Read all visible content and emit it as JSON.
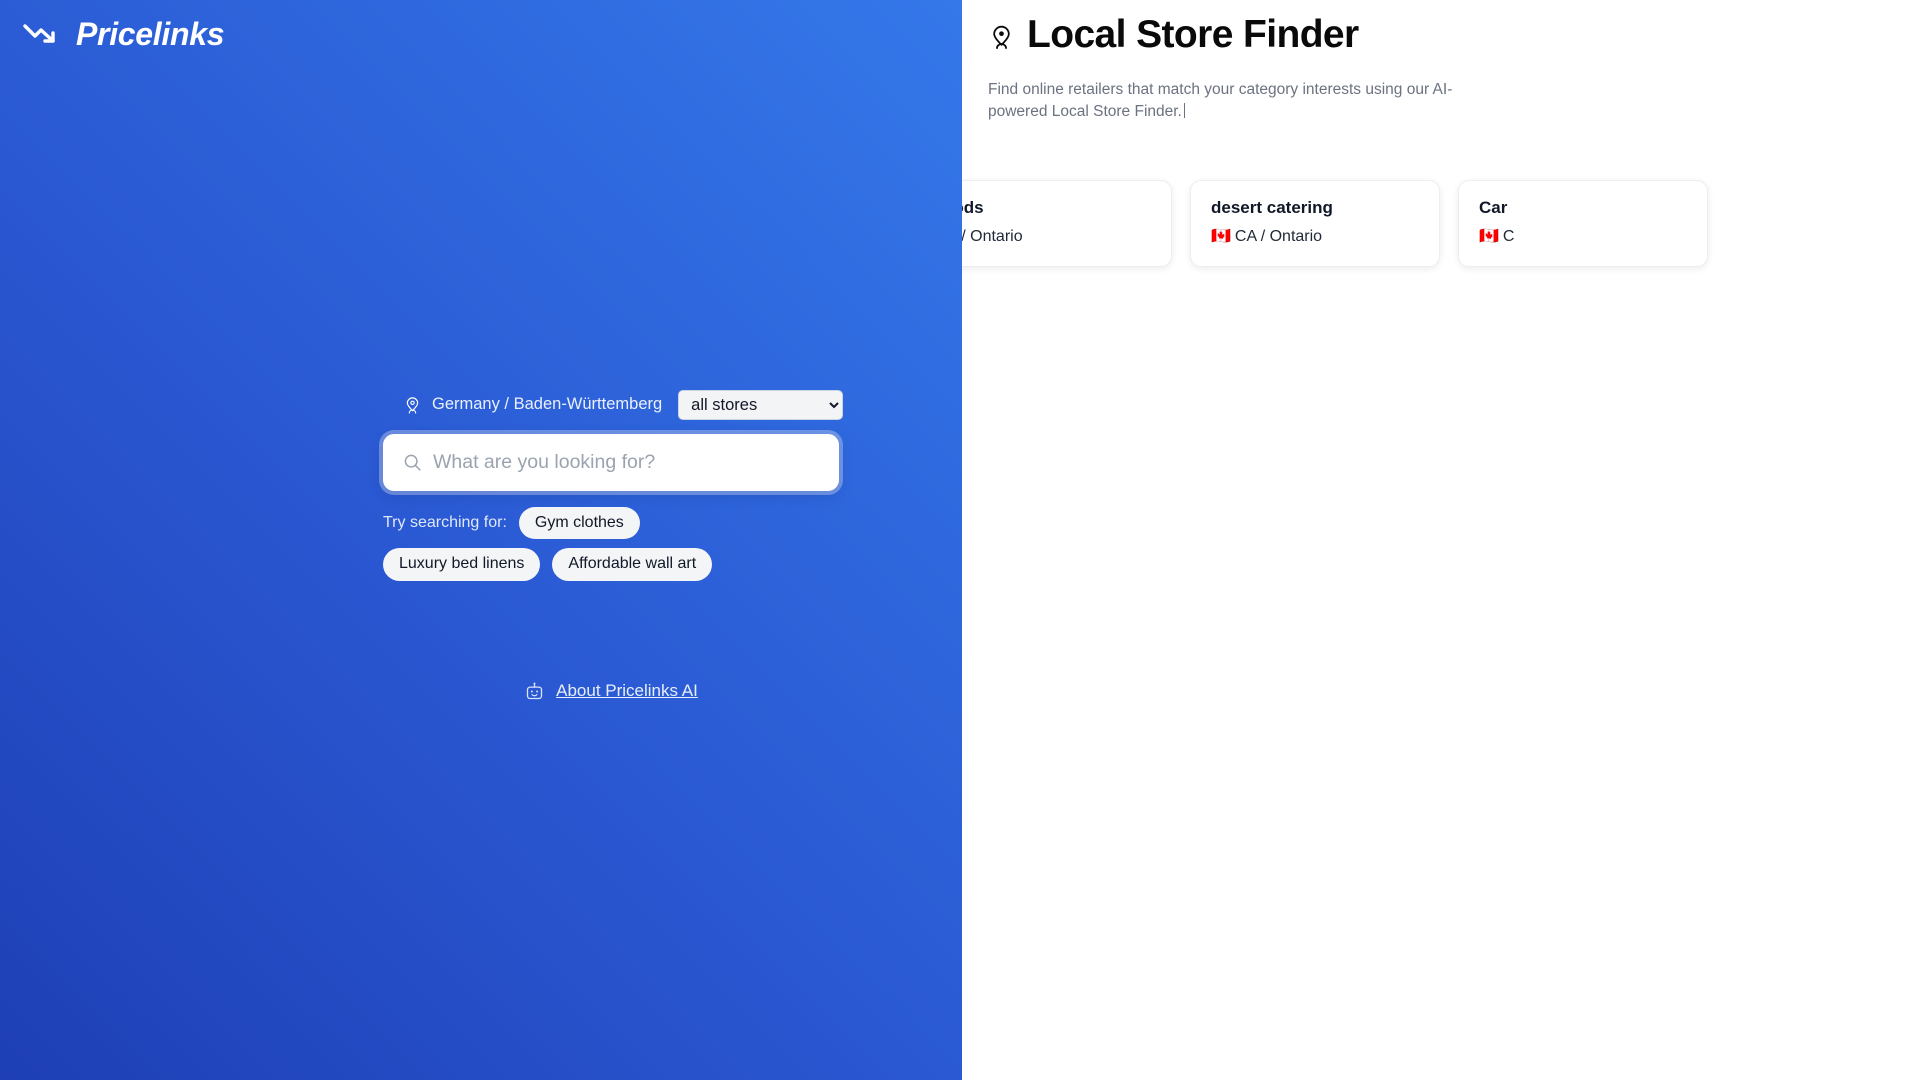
{
  "brand": {
    "name": "Pricelinks",
    "logo_icon": "trending-down-arrow-icon"
  },
  "left_panel": {
    "locale": {
      "icon": "store-locator-pin-icon",
      "text": "Germany / Baden-Württemberg"
    },
    "store_filter": {
      "selected": "all stores",
      "options": [
        "all stores"
      ]
    },
    "search": {
      "icon": "search-icon",
      "value": "",
      "placeholder": "What are you looking for?"
    },
    "suggestions": {
      "label": "Try searching for:",
      "chips": [
        "Gym clothes",
        "Luxury bed linens",
        "Affordable wall art"
      ]
    },
    "about": {
      "icon": "robot-icon",
      "label": "About Pricelinks AI"
    },
    "colors": {
      "gradient_from": "#1e3fb5",
      "gradient_to": "#3478ea"
    }
  },
  "right_panel": {
    "title_icon": "store-locator-pin-icon",
    "title": "Local Store Finder",
    "description": "Find online retailers that match your category interests using our AI-powered Local Store Finder.",
    "stores": [
      {
        "name": "pods",
        "flag": "",
        "region": "A / Ontario"
      },
      {
        "name": "desert catering",
        "flag": "🇨🇦",
        "region": "CA / Ontario"
      },
      {
        "name": "Car",
        "flag": "🇨🇦",
        "region": "C"
      }
    ]
  }
}
